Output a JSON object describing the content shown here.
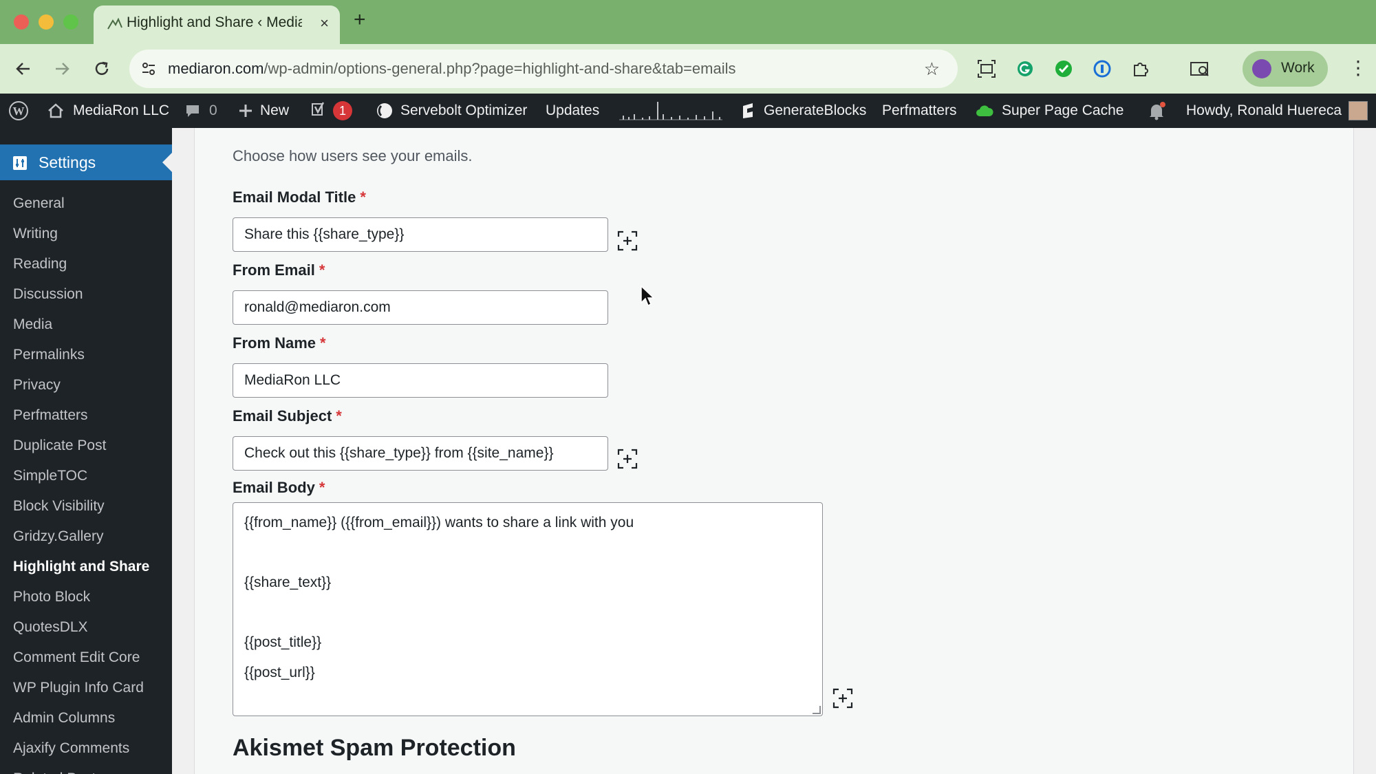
{
  "browser": {
    "tab_title": "Highlight and Share ‹ MediaR",
    "tab_close": "×",
    "new_tab": "+",
    "url_host": "mediaron.com",
    "url_path": "/wp-admin/options-general.php?page=highlight-and-share&tab=emails",
    "profile_label": "Work",
    "menu": "⋮",
    "star": "☆"
  },
  "adminbar": {
    "site_name": "MediaRon LLC",
    "comments_count": "0",
    "new_label": "New",
    "yoast_badge": "1",
    "servebolt": "Servebolt Optimizer",
    "updates": "Updates",
    "generateblocks": "GenerateBlocks",
    "perfmatters": "Perfmatters",
    "super_page_cache": "Super Page Cache",
    "howdy": "Howdy, Ronald Huereca"
  },
  "sidebar": {
    "section": "Settings",
    "items": [
      {
        "label": "General"
      },
      {
        "label": "Writing"
      },
      {
        "label": "Reading"
      },
      {
        "label": "Discussion"
      },
      {
        "label": "Media"
      },
      {
        "label": "Permalinks"
      },
      {
        "label": "Privacy"
      },
      {
        "label": "Perfmatters"
      },
      {
        "label": "Duplicate Post"
      },
      {
        "label": "SimpleTOC"
      },
      {
        "label": "Block Visibility"
      },
      {
        "label": "Gridzy.Gallery"
      },
      {
        "label": "Highlight and Share",
        "current": true
      },
      {
        "label": "Photo Block"
      },
      {
        "label": "QuotesDLX"
      },
      {
        "label": "Comment Edit Core"
      },
      {
        "label": "WP Plugin Info Card"
      },
      {
        "label": "Admin Columns"
      },
      {
        "label": "Ajaxify Comments"
      },
      {
        "label": "Related Posts"
      }
    ]
  },
  "form": {
    "intro": "Choose how users see your emails.",
    "required_mark": "*",
    "modal_title": {
      "label": "Email Modal Title",
      "value": "Share this {{share_type}}"
    },
    "from_email": {
      "label": "From Email",
      "value": "ronald@mediaron.com"
    },
    "from_name": {
      "label": "From Name",
      "value": "MediaRon LLC"
    },
    "subject": {
      "label": "Email Subject",
      "value": "Check out this {{share_type}} from {{site_name}}"
    },
    "body": {
      "label": "Email Body",
      "line1": "{{from_name}} ({{from_email}}) wants to share a link with you",
      "line2": "{{share_text}}",
      "line3": "{{post_title}}",
      "line4": "{{post_url}}"
    },
    "next_section": "Akismet Spam Protection"
  },
  "colors": {
    "admin_dark": "#1d2327",
    "admin_blue": "#2271b1",
    "browser_green": "#79b06e",
    "required_red": "#d63638"
  }
}
